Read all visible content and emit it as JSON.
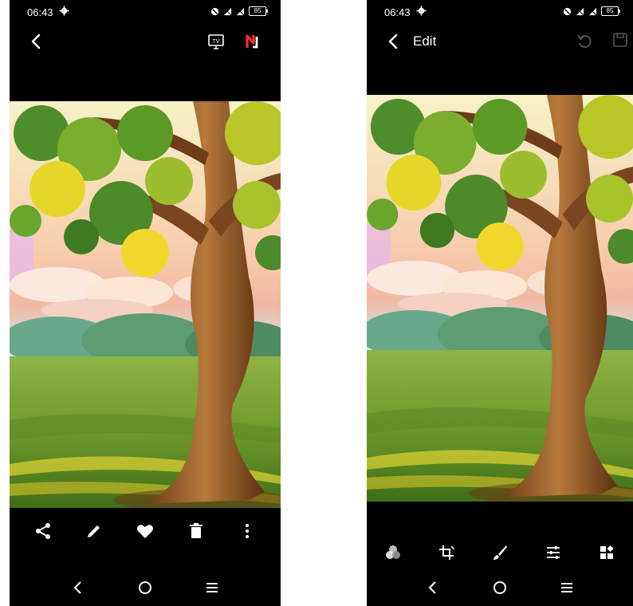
{
  "left": {
    "status": {
      "time": "06:43",
      "battery": "85"
    },
    "topbar": {
      "cast_icon": "tv-cast-icon",
      "app_icon": "n-app-icon",
      "app_color": "#ff2a2a"
    },
    "actions": [
      "share-icon",
      "edit-pencil-icon",
      "favorite-heart-icon",
      "delete-trash-icon",
      "more-vertical-icon"
    ],
    "nav": [
      "nav-back-icon",
      "nav-home-icon",
      "nav-recents-icon"
    ]
  },
  "right": {
    "status": {
      "time": "06:43",
      "battery": "85"
    },
    "topbar": {
      "title": "Edit",
      "undo_icon": "undo-icon",
      "save_icon": "save-icon"
    },
    "tools": [
      "filters-icon",
      "crop-rotate-icon",
      "brush-icon",
      "adjust-sliders-icon",
      "more-tools-icon"
    ],
    "nav": [
      "nav-back-icon",
      "nav-home-icon",
      "nav-recents-icon"
    ]
  },
  "colors": {
    "background": "#000000",
    "foreground": "#ffffff",
    "disabled": "#555555"
  }
}
